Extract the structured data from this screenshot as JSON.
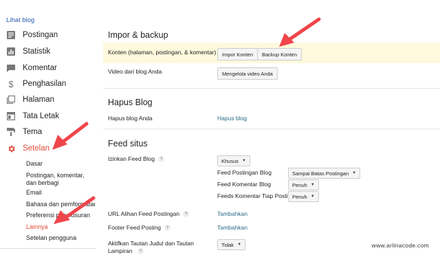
{
  "sidebar": {
    "view_blog": "Lihat blog",
    "items": [
      {
        "label": "Postingan",
        "icon": "posts-icon"
      },
      {
        "label": "Statistik",
        "icon": "stats-icon"
      },
      {
        "label": "Komentar",
        "icon": "comments-icon"
      },
      {
        "label": "Penghasilan",
        "icon": "earnings-icon"
      },
      {
        "label": "Halaman",
        "icon": "pages-icon"
      },
      {
        "label": "Tata Letak",
        "icon": "layout-icon"
      },
      {
        "label": "Tema",
        "icon": "theme-icon"
      },
      {
        "label": "Setelan",
        "icon": "settings-icon",
        "active": true
      }
    ],
    "subitems": [
      {
        "label": "Dasar"
      },
      {
        "label": "Postingan, komentar, dan berbagi"
      },
      {
        "label": "Email"
      },
      {
        "label": "Bahasa dan pemformatan"
      },
      {
        "label": "Preferensi penelusuran"
      },
      {
        "label": "Lainnya",
        "active": true
      },
      {
        "label": "Setelan pengguna"
      }
    ]
  },
  "import_backup": {
    "title": "Impor & backup",
    "content_label": "Konten (halaman, postingan, & komentar)",
    "import_button": "Impor Konten",
    "backup_button": "Backup Konten",
    "video_label": "Video dari blog Anda",
    "manage_video_button": "Mengelola video Anda"
  },
  "delete_blog": {
    "title": "Hapus Blog",
    "label": "Hapus blog Anda",
    "link": "Hapus blog"
  },
  "feed": {
    "title": "Feed situs",
    "allow_label": "Izinkan Feed Blog",
    "allow_value": "Khusus",
    "post_feed_label": "Feed Postingan Blog",
    "post_feed_value": "Sampai Batas Postingan",
    "comment_feed_label": "Feed Komentar Blog",
    "comment_feed_value": "Penuh",
    "per_post_label": "Feeds Komentar Tiap Posting",
    "per_post_value": "Penuh",
    "redirect_label": "URL Alihan Feed Postingan",
    "redirect_link": "Tambahkan",
    "footer_label": "Footer Feed Posting",
    "footer_link": "Tambahkan",
    "title_links_label": "Aktifkan Tautan Judul dan Tautan Lampiran",
    "title_links_value": "Tidak"
  },
  "help_glyph": "?",
  "caret_glyph": "▼",
  "watermark": "www.arlinacode.com",
  "colors": {
    "active": "#dd4b39",
    "link": "#2a6a8a",
    "highlight": "#fff9dd",
    "arrow": "#f0454a"
  }
}
